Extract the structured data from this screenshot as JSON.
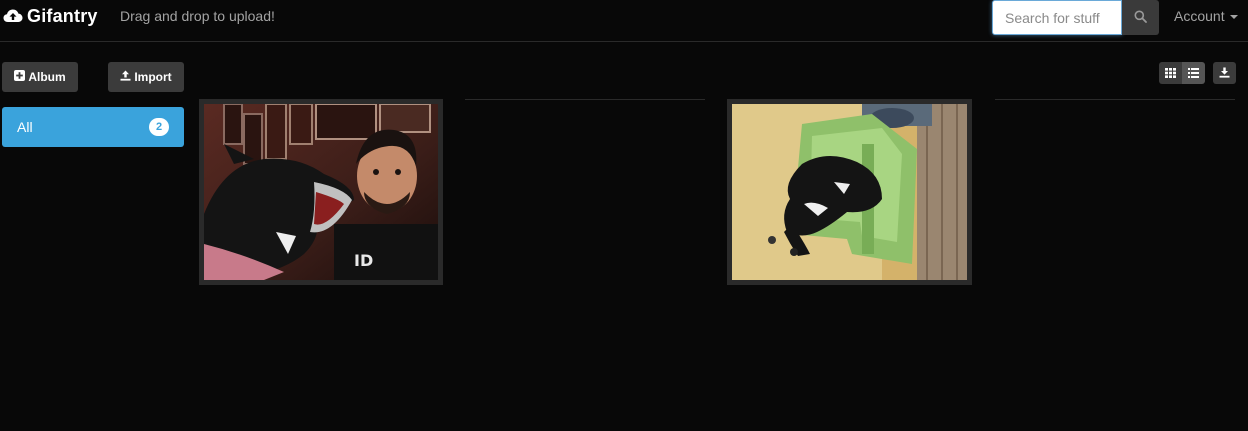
{
  "navbar": {
    "brand_icon": "cloud-upload-icon",
    "brand": "Gifantry",
    "tagline": "Drag and drop to upload!",
    "search": {
      "placeholder": "Search for stuff",
      "value": "",
      "icon": "search-icon"
    },
    "account_label": "Account"
  },
  "toolbar": {
    "album_label": "Album",
    "album_icon": "plus-square-icon",
    "import_label": "Import",
    "import_icon": "upload-icon",
    "view_buttons": [
      "grid-view-icon",
      "list-view-icon"
    ],
    "download_icon": "download-icon"
  },
  "sidebar": {
    "albums": [
      {
        "label": "All",
        "count": "2",
        "active": true
      }
    ]
  },
  "gallery": {
    "items": [
      {
        "name": "dog-and-man-photo"
      },
      {
        "name": "dog-on-green-chair-photo"
      }
    ]
  },
  "colors": {
    "accent": "#3aa3dc",
    "background": "#080808",
    "button": "#3b3b3b"
  }
}
